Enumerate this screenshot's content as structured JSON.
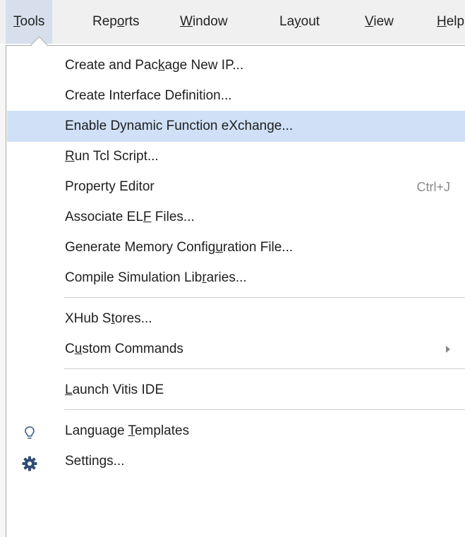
{
  "menubar": {
    "items": [
      {
        "pre": "",
        "u": "T",
        "post": "ools"
      },
      {
        "pre": "Rep",
        "u": "o",
        "post": "rts"
      },
      {
        "pre": "",
        "u": "W",
        "post": "indow"
      },
      {
        "pre": "La",
        "u": "y",
        "post": "out"
      },
      {
        "pre": "",
        "u": "V",
        "post": "iew"
      },
      {
        "pre": "",
        "u": "H",
        "post": "elp"
      }
    ]
  },
  "menu": {
    "items": [
      {
        "pre": "Create and Pac",
        "u": "k",
        "post": "age New IP..."
      },
      {
        "pre": "Create Interface Definition...",
        "u": "",
        "post": ""
      },
      {
        "pre": "Enable Dynamic Function eXchange...",
        "u": "",
        "post": ""
      },
      {
        "pre": "",
        "u": "R",
        "post": "un Tcl Script..."
      },
      {
        "pre": "Property Editor",
        "u": "",
        "post": "",
        "shortcut": "Ctrl+J"
      },
      {
        "pre": "Associate EL",
        "u": "F",
        "post": " Files..."
      },
      {
        "pre": "Generate Memory Config",
        "u": "u",
        "post": "ration File..."
      },
      {
        "pre": "Compile Simulation Lib",
        "u": "r",
        "post": "aries..."
      },
      {
        "pre": "XHub S",
        "u": "t",
        "post": "ores..."
      },
      {
        "pre": "C",
        "u": "u",
        "post": "stom Commands"
      },
      {
        "pre": "",
        "u": "L",
        "post": "aunch Vitis IDE"
      },
      {
        "pre": "Language ",
        "u": "T",
        "post": "emplates"
      },
      {
        "pre": "Settings...",
        "u": "",
        "post": ""
      }
    ]
  },
  "colors": {
    "highlight": "#cfe0f7",
    "menubar_active": "#d6dfeb",
    "gear_icon": "#2f4d75"
  }
}
